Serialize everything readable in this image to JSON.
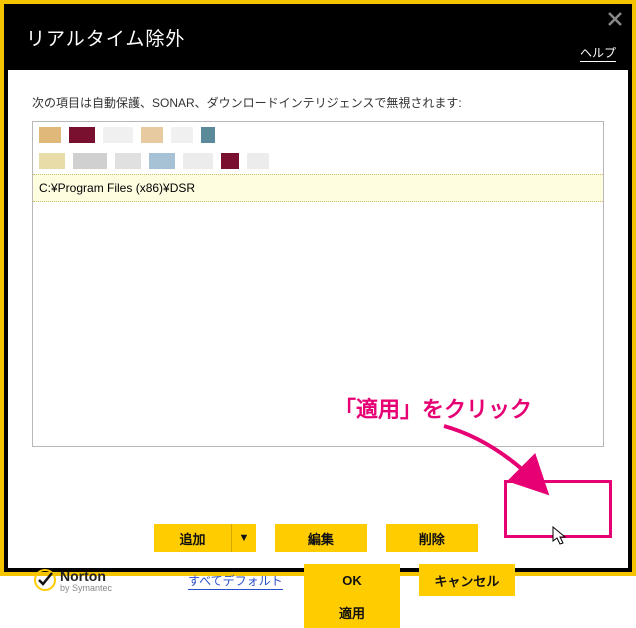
{
  "titlebar": {
    "title": "リアルタイム除外",
    "help": "ヘルプ"
  },
  "description": "次の項目は自動保護、SONAR、ダウンロードインテリジェンスで無視されます:",
  "list": {
    "row3": "C:¥Program Files (x86)¥DSR"
  },
  "row1_buttons": {
    "add": "追加",
    "arrow": "▼",
    "edit": "編集",
    "delete": "削除"
  },
  "row2_buttons": {
    "ok": "OK",
    "cancel": "キャンセル",
    "apply": "適用"
  },
  "defaults_link": "すべてデフォルト",
  "branding": {
    "name": "Norton",
    "by": "by Symantec"
  },
  "annotation": {
    "text": "「適用」をクリック"
  }
}
